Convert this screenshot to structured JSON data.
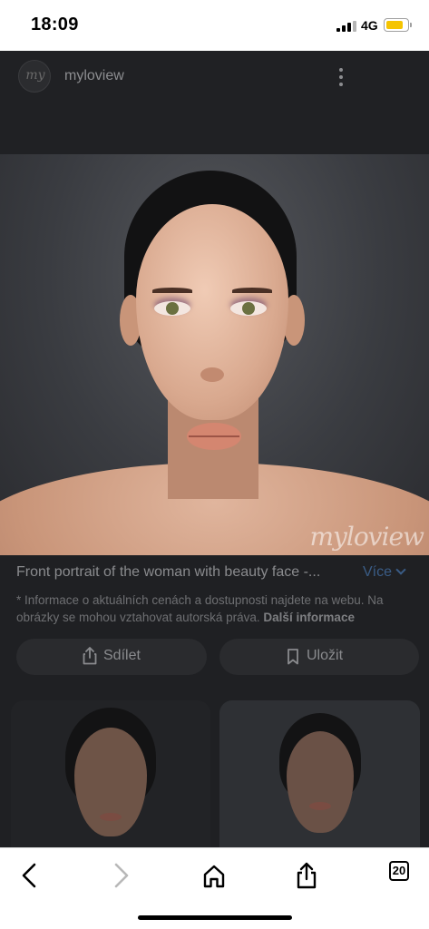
{
  "status_bar": {
    "time": "18:09",
    "network": "4G",
    "battery_color": "#f5c400"
  },
  "header": {
    "avatar_text": "my",
    "site_name": "myloview",
    "menu_icon": "kebab-icon"
  },
  "image": {
    "watermark": "myloview"
  },
  "caption": {
    "title": "Front portrait of the woman with beauty face -...",
    "more_label": "Více",
    "disclaimer": "* Informace o aktuálních cenách a dostupnosti najdete na webu. Na obrázky se mohou vztahovat autorská práva.",
    "more_info_label": "Další informace"
  },
  "actions": {
    "share_label": "Sdílet",
    "save_label": "Uložit"
  },
  "toolbar": {
    "tab_count": "20"
  },
  "colors": {
    "link": "#3a5c86",
    "overlay": "#1f2023"
  }
}
